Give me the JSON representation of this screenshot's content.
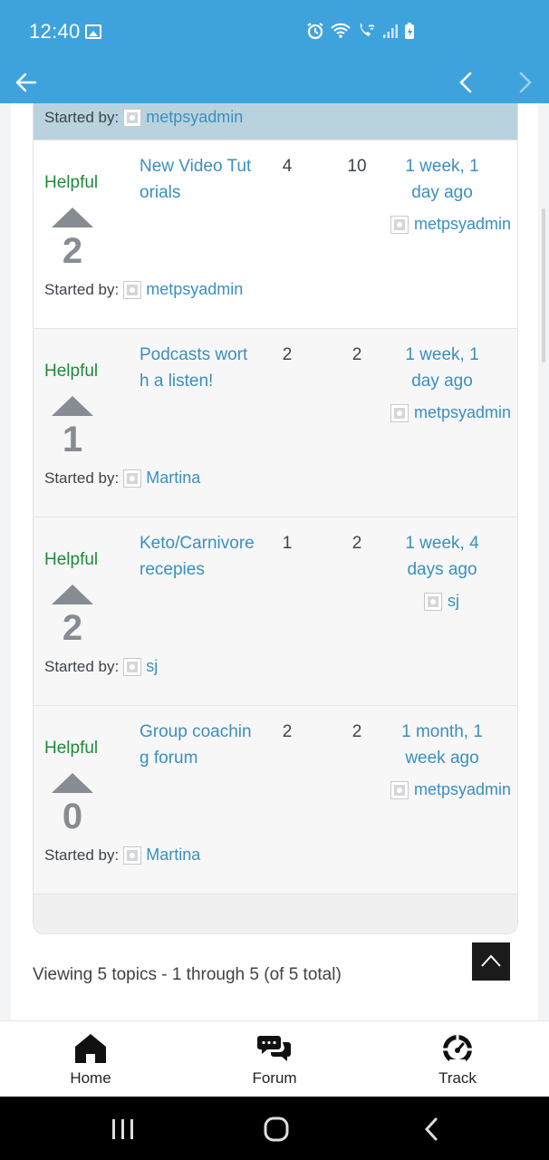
{
  "status_bar": {
    "time": "12:40"
  },
  "topics": [
    {
      "title": "New Video Tutorials",
      "voices": "4",
      "posts": "10",
      "freshness": "1 week, 1 day ago",
      "freshness_user": "metpsyadmin",
      "helpful_label": "Helpful",
      "votes": "2",
      "started_label": "Started by:",
      "started_by": "metpsyadmin"
    },
    {
      "title": "Podcasts worth a listen!",
      "voices": "2",
      "posts": "2",
      "freshness": "1 week, 1 day ago",
      "freshness_user": "metpsyadmin",
      "helpful_label": "Helpful",
      "votes": "1",
      "started_label": "Started by:",
      "started_by": "Martina"
    },
    {
      "title": "Keto/Carnivore recepies",
      "voices": "1",
      "posts": "2",
      "freshness": "1 week, 4 days ago",
      "freshness_user": "sj",
      "helpful_label": "Helpful",
      "votes": "2",
      "started_label": "Started by:",
      "started_by": "sj"
    },
    {
      "title": "Group coaching forum",
      "voices": "2",
      "posts": "2",
      "freshness": "1 month, 1 week ago",
      "freshness_user": "metpsyadmin",
      "helpful_label": "Helpful",
      "votes": "0",
      "started_label": "Started by:",
      "started_by": "Martina"
    }
  ],
  "sticky_tail": {
    "started_label": "Started by:",
    "started_by": "metpsyadmin"
  },
  "pagination": {
    "summary": "Viewing 5 topics - 1 through 5 (of 5 total)"
  },
  "bottom_nav": {
    "items": [
      {
        "label": "Home",
        "icon": "home-icon"
      },
      {
        "label": "Forum",
        "icon": "chat-bubbles-icon"
      },
      {
        "label": "Track",
        "icon": "speedometer-icon"
      }
    ]
  },
  "colors": {
    "brand": "#3ea3dd",
    "link": "#3a8fbf",
    "helpful": "#1d8a3a",
    "vote": "#868c92",
    "sticky_row": "#b9d3de"
  }
}
